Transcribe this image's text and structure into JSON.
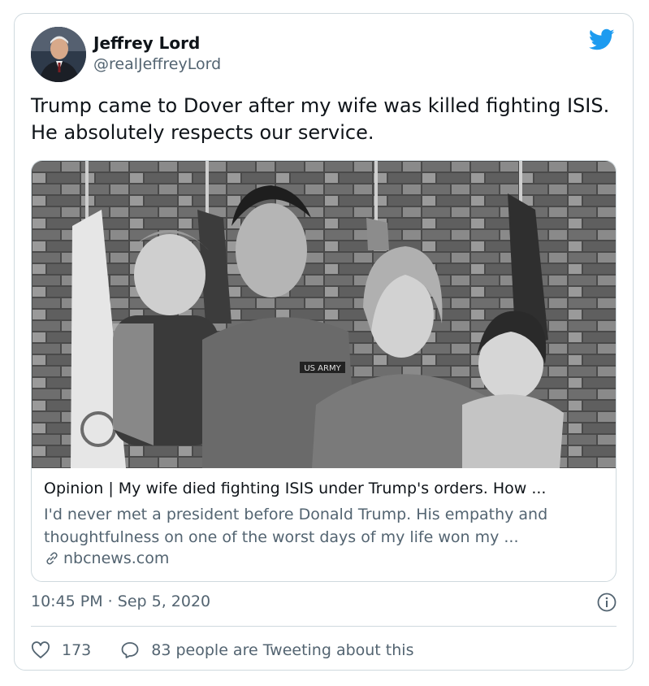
{
  "user": {
    "name": "Jeffrey Lord",
    "handle": "@realJeffreyLord"
  },
  "tweet": {
    "text": "Trump came to Dover after my wife was killed fighting ISIS. He absolutely respects our service."
  },
  "link_card": {
    "title": "Opinion | My wife died fighting ISIS under Trump's orders. How ...",
    "description": "I'd never met a president before Donald Trump. His empathy and thoughtfulness on one of the worst days of my life won my ...",
    "domain": "nbcnews.com",
    "image_badge": "US ARMY"
  },
  "meta": {
    "timestamp": "10:45 PM · Sep 5, 2020"
  },
  "actions": {
    "likes": "173",
    "replies": "83 people are Tweeting about this"
  },
  "colors": {
    "brand_blue": "#1d9bf0",
    "secondary_text": "#536471",
    "border": "#cfd9de"
  },
  "icons": [
    "twitter-bird-icon",
    "info-icon",
    "heart-icon",
    "reply-bubble-icon",
    "link-icon"
  ]
}
